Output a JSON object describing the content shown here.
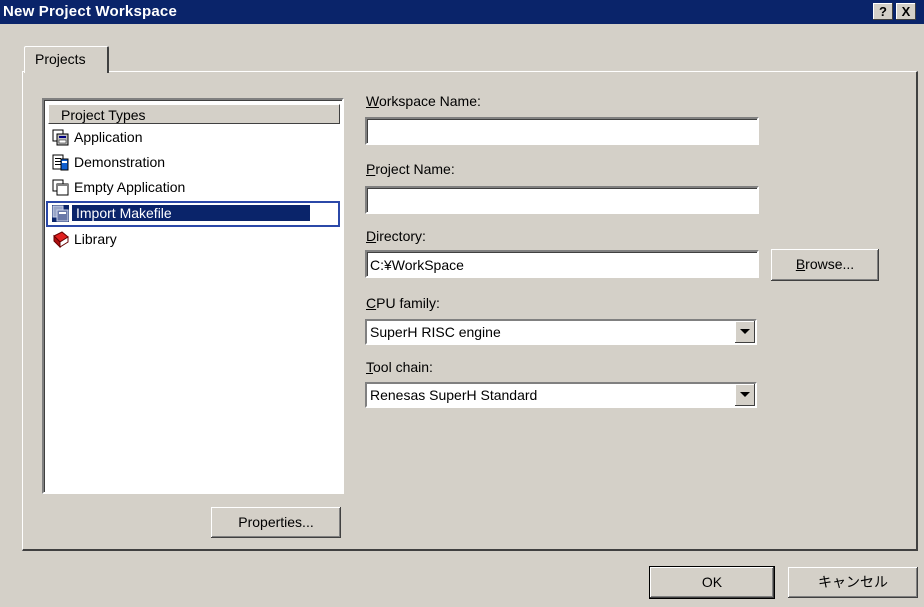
{
  "window": {
    "title": "New Project Workspace",
    "help_label": "?",
    "close_label": "X"
  },
  "tabs": [
    {
      "label": "Projects"
    }
  ],
  "project_types": {
    "header": "Project Types",
    "items": [
      {
        "label": "Application",
        "icon": "application-icon"
      },
      {
        "label": "Demonstration",
        "icon": "demonstration-icon"
      },
      {
        "label": "Empty Application",
        "icon": "empty-application-icon"
      },
      {
        "label": "Import Makefile",
        "icon": "import-makefile-icon",
        "selected": true
      },
      {
        "label": "Library",
        "icon": "library-icon"
      }
    ]
  },
  "workspace_name": {
    "accel": "W",
    "rest": "orkspace Name:",
    "value": ""
  },
  "project_name": {
    "accel": "P",
    "rest": "roject Name:",
    "value": ""
  },
  "directory": {
    "accel": "D",
    "rest": "irectory:",
    "value": "C:¥WorkSpace"
  },
  "cpu_family": {
    "accel": "C",
    "rest": "PU family:",
    "value": "SuperH RISC engine"
  },
  "tool_chain": {
    "accel": "T",
    "rest": "ool chain:",
    "value": "Renesas SuperH Standard"
  },
  "buttons": {
    "browse_accel": "B",
    "browse_rest": "rowse...",
    "properties": "Properties...",
    "ok": "OK",
    "cancel": "キャンセル"
  }
}
